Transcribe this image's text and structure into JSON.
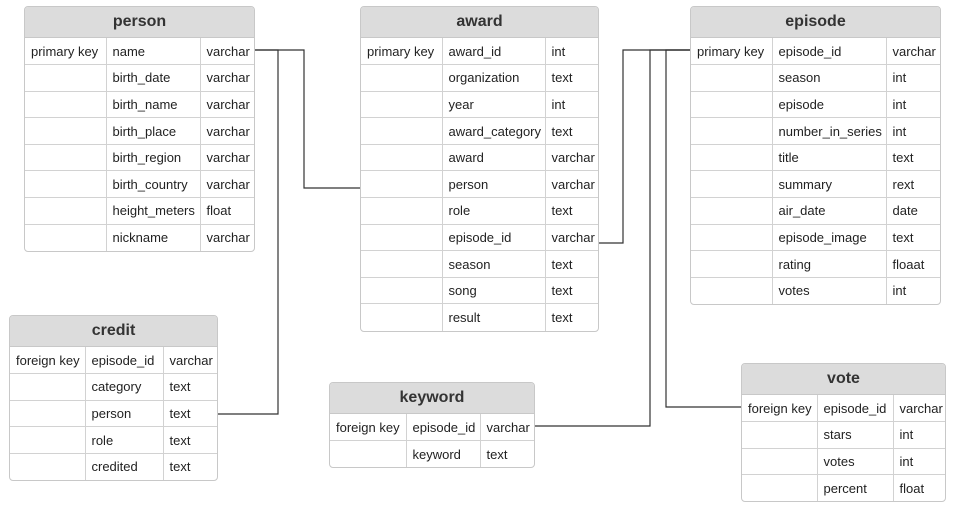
{
  "entities": {
    "person": {
      "title": "person",
      "rows": [
        {
          "key": "primary key",
          "name": "name",
          "type": "varchar"
        },
        {
          "key": "",
          "name": "birth_date",
          "type": "varchar"
        },
        {
          "key": "",
          "name": "birth_name",
          "type": "varchar"
        },
        {
          "key": "",
          "name": "birth_place",
          "type": "varchar"
        },
        {
          "key": "",
          "name": "birth_region",
          "type": "varchar"
        },
        {
          "key": "",
          "name": "birth_country",
          "type": "varchar"
        },
        {
          "key": "",
          "name": "height_meters",
          "type": "float"
        },
        {
          "key": "",
          "name": "nickname",
          "type": "varchar"
        }
      ]
    },
    "award": {
      "title": "award",
      "rows": [
        {
          "key": "primary key",
          "name": "award_id",
          "type": "int"
        },
        {
          "key": "",
          "name": "organization",
          "type": "text"
        },
        {
          "key": "",
          "name": "year",
          "type": "int"
        },
        {
          "key": "",
          "name": "award_category",
          "type": "text"
        },
        {
          "key": "",
          "name": "award",
          "type": "varchar"
        },
        {
          "key": "",
          "name": "person",
          "type": "varchar"
        },
        {
          "key": "",
          "name": "role",
          "type": "text"
        },
        {
          "key": "",
          "name": "episode_id",
          "type": "varchar"
        },
        {
          "key": "",
          "name": "season",
          "type": "text"
        },
        {
          "key": "",
          "name": "song",
          "type": "text"
        },
        {
          "key": "",
          "name": "result",
          "type": "text"
        }
      ]
    },
    "episode": {
      "title": "episode",
      "rows": [
        {
          "key": "primary key",
          "name": "episode_id",
          "type": "varchar"
        },
        {
          "key": "",
          "name": "season",
          "type": "int"
        },
        {
          "key": "",
          "name": "episode",
          "type": "int"
        },
        {
          "key": "",
          "name": "number_in_series",
          "type": "int"
        },
        {
          "key": "",
          "name": "title",
          "type": "text"
        },
        {
          "key": "",
          "name": "summary",
          "type": "rext"
        },
        {
          "key": "",
          "name": "air_date",
          "type": "date"
        },
        {
          "key": "",
          "name": "episode_image",
          "type": "text"
        },
        {
          "key": "",
          "name": "rating",
          "type": "floaat"
        },
        {
          "key": "",
          "name": "votes",
          "type": "int"
        }
      ]
    },
    "credit": {
      "title": "credit",
      "rows": [
        {
          "key": "foreign key",
          "name": "episode_id",
          "type": "varchar"
        },
        {
          "key": "",
          "name": "category",
          "type": "text"
        },
        {
          "key": "",
          "name": "person",
          "type": "text"
        },
        {
          "key": "",
          "name": "role",
          "type": "text"
        },
        {
          "key": "",
          "name": "credited",
          "type": "text"
        }
      ]
    },
    "keyword": {
      "title": "keyword",
      "rows": [
        {
          "key": "foreign key",
          "name": "episode_id",
          "type": "varchar"
        },
        {
          "key": "",
          "name": "keyword",
          "type": "text"
        }
      ]
    },
    "vote": {
      "title": "vote",
      "rows": [
        {
          "key": "foreign key",
          "name": "episode_id",
          "type": "varchar"
        },
        {
          "key": "",
          "name": "stars",
          "type": "int"
        },
        {
          "key": "",
          "name": "votes",
          "type": "int"
        },
        {
          "key": "",
          "name": "percent",
          "type": "float"
        }
      ]
    }
  },
  "relationships": [
    {
      "from": "award.person",
      "to": "person.name"
    },
    {
      "from": "credit.person",
      "to": "person.name"
    },
    {
      "from": "award.episode_id",
      "to": "episode.episode_id"
    },
    {
      "from": "keyword.episode_id",
      "to": "episode.episode_id"
    },
    {
      "from": "vote.episode_id",
      "to": "episode.episode_id"
    }
  ]
}
